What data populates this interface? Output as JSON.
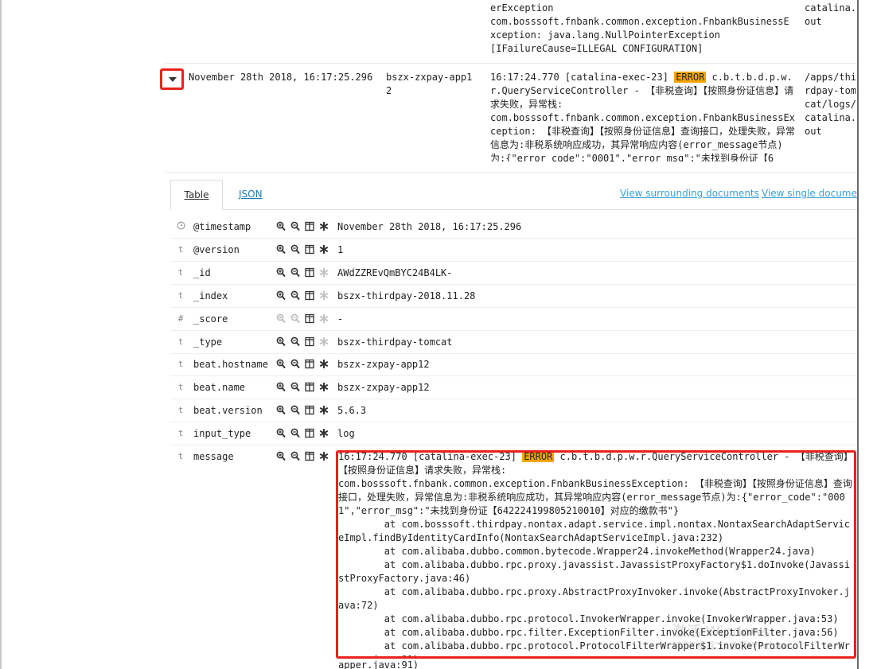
{
  "row1": {
    "message_lines": "erException\ncom.bosssoft.fnbank.common.exception.FnbankBusinessE\nxception: java.lang.NullPointerException\n[IFailureCause=ILLEGAL CONFIGURATION]",
    "source": "catalina.\nout"
  },
  "row2": {
    "time": "November 28th 2018, 16:17:25.296",
    "host": "bszx-zxpay-app1\n2",
    "message_prefix": "16:17:24.770 [catalina-exec-23] ",
    "level": "ERROR",
    "message_rest": " c.b.t.b.d.p.w.r.QueryServiceController - 【非税查询】【按照身份证信息】请求失败，异常栈:\ncom.bosssoft.fnbank.common.exception.FnbankBusinessException: 【非税查询】【按照身份证信息】查询接口，处理失败，异常信息为:非税系统响应成功，其异常响应内容(error_message节点)为:{\"error_code\":\"0001\",\"error_msg\":\"未找到身份证【6",
    "source": "/apps/thirdpay-tomcat/logs/catalina.out"
  },
  "tabs": {
    "table": "Table",
    "json": "JSON"
  },
  "links": {
    "surrounding": "View surrounding documents",
    "single": "View single document"
  },
  "fields": [
    {
      "type": "clock",
      "name": "@timestamp",
      "value": "November 28th 2018, 16:17:25.296"
    },
    {
      "type": "t",
      "name": "@version",
      "value": "1"
    },
    {
      "type": "t",
      "name": "_id",
      "value": "AWdZZREvQmBYC24B4LK-"
    },
    {
      "type": "t",
      "name": "_index",
      "value": "bszx-thirdpay-2018.11.28"
    },
    {
      "type": "#",
      "name": "_score",
      "value": " -"
    },
    {
      "type": "t",
      "name": "_type",
      "value": "bszx-thirdpay-tomcat"
    },
    {
      "type": "t",
      "name": "beat.hostname",
      "value": "bszx-zxpay-app12"
    },
    {
      "type": "t",
      "name": "beat.name",
      "value": "bszx-zxpay-app12"
    },
    {
      "type": "t",
      "name": "beat.version",
      "value": "5.6.3"
    },
    {
      "type": "t",
      "name": "input_type",
      "value": "log"
    },
    {
      "type": "t",
      "name": "message",
      "value": ""
    }
  ],
  "message_field": {
    "prefix": "16:17:24.770 [catalina-exec-23] ",
    "level": "ERROR",
    "body": " c.b.t.b.d.p.w.r.QueryServiceController - 【非税查询】【按照身份证信息】请求失败，异常栈:\ncom.bosssoft.fnbank.common.exception.FnbankBusinessException: 【非税查询】【按照身份证信息】查询接口，处理失败，异常信息为:非税系统响应成功，其异常响应内容(error_message节点)为:{\"error_code\":\"0001\",\"error_msg\":\"未找到身份证【642224199805210010】对应的缴款书\"}\n        at com.bosssoft.thirdpay.nontax.adapt.service.impl.nontax.NontaxSearchAdaptServiceImpl.findByIdentityCardInfo(NontaxSearchAdaptServiceImpl.java:232)\n        at com.alibaba.dubbo.common.bytecode.Wrapper24.invokeMethod(Wrapper24.java)\n        at com.alibaba.dubbo.rpc.proxy.javassist.JavassistProxyFactory$1.doInvoke(JavassistProxyFactory.java:46)\n        at com.alibaba.dubbo.rpc.proxy.AbstractProxyInvoker.invoke(AbstractProxyInvoker.java:72)\n        at com.alibaba.dubbo.rpc.protocol.InvokerWrapper.invoke(InvokerWrapper.java:53)\n        at com.alibaba.dubbo.rpc.filter.ExceptionFilter.invoke(ExceptionFilter.java:56)\n        at com.alibaba.dubbo.rpc.protocol.ProtocolFilterWrapper$1.invoke(ProtocolFilterWrapper.java:91)",
    "overflow_tail": "apper.java:91)"
  },
  "watermark": {
    "line1": "激活 Windows",
    "line2": "转到\"设置\"以激活Windows。"
  },
  "colors": {
    "error_bg": "#f5a700",
    "highlight_border": "#e8231c",
    "link": "#3aa0d6"
  }
}
